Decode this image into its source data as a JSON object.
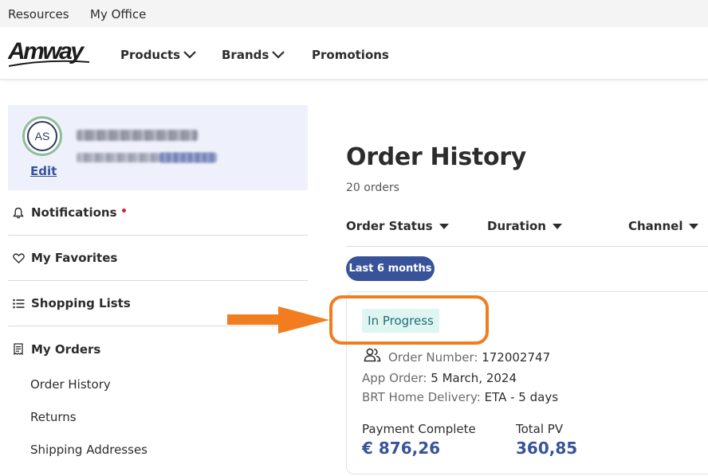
{
  "utility": {
    "resources_label": "Resources",
    "my_office_label": "My Office"
  },
  "nav": {
    "logo_text": "Amway",
    "items": [
      {
        "label": "Products",
        "icon": "chevron-down-icon"
      },
      {
        "label": "Brands",
        "icon": "chevron-down-icon"
      },
      {
        "label": "Promotions"
      }
    ]
  },
  "profile": {
    "initials": "AS",
    "edit_label": "Edit",
    "name_blurred": true,
    "abo_number_blurred": true
  },
  "sidebar": {
    "items": [
      {
        "label": "Notifications",
        "icon": "bell-icon",
        "has_unread_dot": true
      },
      {
        "label": "My Favorites",
        "icon": "heart-icon"
      },
      {
        "label": "Shopping Lists",
        "icon": "list-icon"
      },
      {
        "label": "My Orders",
        "icon": "receipt-icon"
      }
    ],
    "orders_sub": [
      {
        "label": "Order History"
      },
      {
        "label": "Returns"
      },
      {
        "label": "Shipping Addresses"
      }
    ]
  },
  "main": {
    "title": "Order History",
    "count": "20 orders",
    "filters": [
      {
        "label": "Order Status"
      },
      {
        "label": "Duration"
      },
      {
        "label": "Channel"
      }
    ],
    "active_chip": "Last 6 months"
  },
  "order": {
    "status": "In Progress",
    "order_number_label": "Order Number: ",
    "order_number": "172002747",
    "app_order_label": "App Order: ",
    "app_order_date": "5 March, 2024",
    "delivery_label": "BRT Home Delivery: ",
    "delivery_eta": "ETA - 5 days",
    "payment_label": "Payment Complete",
    "payment_value": "€ 876,26",
    "pv_label": "Total PV",
    "pv_value": "360,85"
  },
  "colors": {
    "brand_blue": "#38539a",
    "highlight_orange": "#f27d1f",
    "status_bg": "#dff5f1",
    "status_text": "#1f6e78",
    "notification_dot": "#d1212f"
  }
}
